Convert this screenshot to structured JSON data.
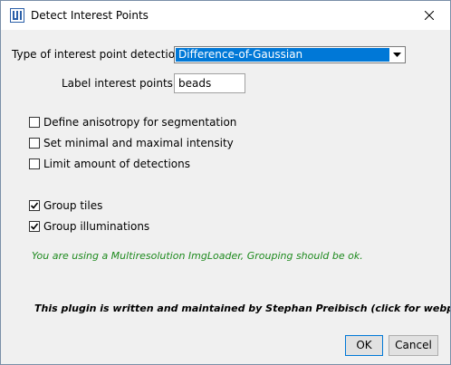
{
  "window": {
    "title": "Detect Interest Points",
    "app_icon": "imagej-icon",
    "close_icon": "close-icon"
  },
  "form": {
    "detection_type_label": "Type of interest point detection",
    "detection_type_value": "Difference-of-Gaussian",
    "label_interest_points_label": "Label interest points",
    "label_interest_points_value": "beads"
  },
  "options": [
    {
      "label": "Define anisotropy for segmentation",
      "checked": false
    },
    {
      "label": "Set minimal and maximal intensity",
      "checked": false
    },
    {
      "label": "Limit amount of detections",
      "checked": false
    }
  ],
  "grouping": [
    {
      "label": "Group tiles",
      "checked": true
    },
    {
      "label": "Group illuminations",
      "checked": true
    }
  ],
  "info_message": "You are using a Multiresolution ImgLoader, Grouping should be ok.",
  "info_color": "#1e8a1e",
  "footer_link": "This plugin is written and maintained by Stephan Preibisch (click for webpage)",
  "buttons": {
    "ok": "OK",
    "cancel": "Cancel"
  },
  "colors": {
    "selection": "#0078d7",
    "dialog_bg": "#f0f0f0"
  }
}
